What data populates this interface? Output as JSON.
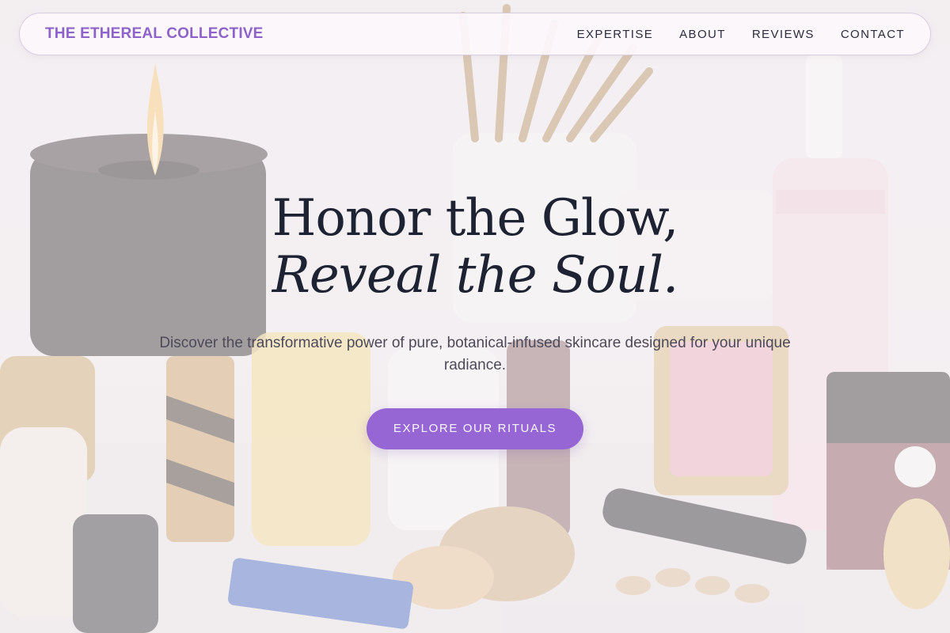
{
  "nav": {
    "brand": "THE ETHEREAL COLLECTIVE",
    "links": [
      "EXPERTISE",
      "ABOUT",
      "REVIEWS",
      "CONTACT"
    ]
  },
  "hero": {
    "headline_line1": "Honor the Glow,",
    "headline_line2": "Reveal the Soul.",
    "subtext": "Discover the transformative power of pure, botanical-infused skincare designed for your unique radiance.",
    "cta_label": "EXPLORE OUR RITUALS"
  },
  "theme": {
    "accent": "#9566d4",
    "brand_color": "#8e63c9",
    "heading_color": "#1e2333"
  }
}
